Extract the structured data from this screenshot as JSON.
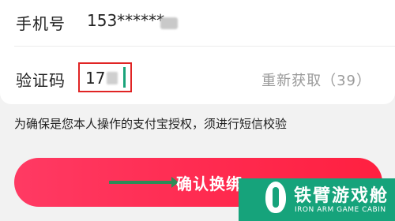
{
  "form": {
    "phone_label": "手机号",
    "phone_value": "153******",
    "code_label": "验证码",
    "code_value": "17",
    "resend_label": "重新获取（39）"
  },
  "notice": "为确保是您本人操作的支付宝授权，须进行短信校验",
  "confirm_button": {
    "label": "确认换绑"
  },
  "watermark": {
    "title": "铁臂游戏舱",
    "subtitle": "IRON ARM GAME CABIN"
  },
  "colors": {
    "button": "#ff2a4f",
    "highlight_box": "#e02424",
    "caret": "#1aa37a",
    "watermark": "#16a37b"
  }
}
